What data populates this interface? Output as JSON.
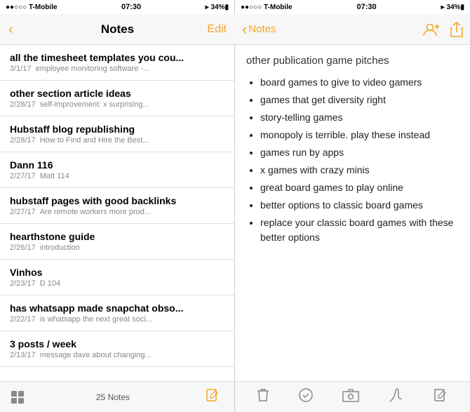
{
  "left": {
    "statusBar": {
      "carrier": "●●○○○ T-Mobile",
      "time": "07:30",
      "signal": "▸ 34%",
      "batteryIcon": "🔋"
    },
    "navBar": {
      "backIcon": "‹",
      "title": "Notes",
      "editBtn": "Edit"
    },
    "notes": [
      {
        "title": "all the timesheet templates you cou...",
        "date": "3/1/17",
        "preview": "employee monitoring software -..."
      },
      {
        "title": "other section article ideas",
        "date": "2/28/17",
        "preview": "self-improvement: x surprising..."
      },
      {
        "title": "Hubstaff blog republishing",
        "date": "2/28/17",
        "preview": "How to Find and Hire the Best..."
      },
      {
        "title": "Dann 116",
        "date": "2/27/17",
        "preview": "Matt 114"
      },
      {
        "title": "hubstaff pages with good backlinks",
        "date": "2/27/17",
        "preview": "Are remote workers more prod..."
      },
      {
        "title": "hearthstone guide",
        "date": "2/26/17",
        "preview": "introduction"
      },
      {
        "title": "Vinhos",
        "date": "2/23/17",
        "preview": "D 104"
      },
      {
        "title": "has whatsapp made snapchat obso...",
        "date": "2/22/17",
        "preview": "is whatsapp the next great soci..."
      },
      {
        "title": "3 posts / week",
        "date": "2/13/17",
        "preview": "message dave about changing..."
      }
    ],
    "toolbar": {
      "count": "25 Notes"
    }
  },
  "right": {
    "statusBar": {
      "carrier": "●●○○○ T-Mobile",
      "time": "07:30",
      "signal": "▸ 34%"
    },
    "navBar": {
      "backLabel": "Notes",
      "backIcon": "‹"
    },
    "note": {
      "title": "other publication game pitches",
      "bullets": [
        "board games to give to video gamers",
        "games that get diversity right",
        "story-telling games",
        "monopoly is terrible. play these instead",
        "games run by apps",
        "x games with crazy minis",
        "great board games to play online",
        "better options to classic board games",
        "replace your classic board games with these better options"
      ]
    },
    "toolbar": {
      "deleteIcon": "🗑",
      "checkIcon": "✓",
      "cameraIcon": "📷",
      "sketchIcon": "✏",
      "composeIcon": "✏"
    }
  }
}
